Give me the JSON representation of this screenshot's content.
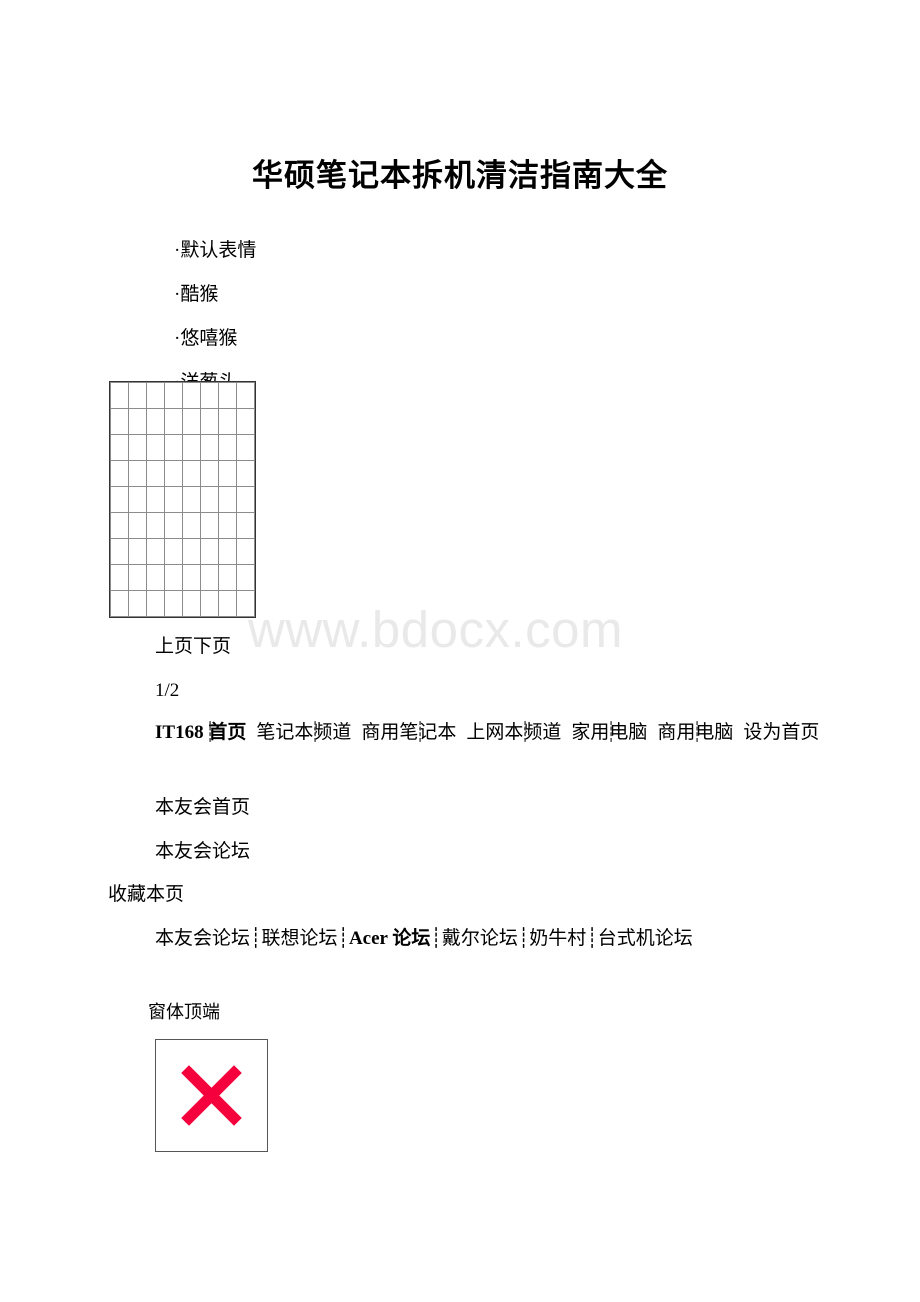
{
  "document": {
    "title": "华硕笔记本拆机清洁指南大全",
    "watermark": "www.bdocx.com"
  },
  "emoticon_list": [
    {
      "bullet": "·",
      "label": "默认表情"
    },
    {
      "bullet": "·",
      "label": "酷猴"
    },
    {
      "bullet": "·",
      "label": "悠嘻猴"
    },
    {
      "bullet": "·",
      "label": "洋葱头"
    }
  ],
  "emoticon_grid": {
    "columns": 8,
    "rows": 9,
    "cells_empty": true,
    "border_color": "#8c8c8c",
    "outline_color": "#333333"
  },
  "pager": {
    "prev_next": "上页下页",
    "page_indicator": "1/2"
  },
  "site_nav": {
    "separator": "┊",
    "items": [
      "IT168 首页",
      "笔记本频道",
      "商用笔记本",
      "上网本频道",
      "家用电脑",
      "商用电脑",
      "设为首页"
    ]
  },
  "club_links": [
    "本友会首页",
    "本友会论坛",
    "收藏本页"
  ],
  "forum_nav": {
    "separator": "┊",
    "items": [
      "本友会论坛",
      "联想论坛",
      "Acer 论坛",
      "戴尔论坛",
      "奶牛村",
      "台式机论坛"
    ]
  },
  "form": {
    "top_marker": "窗体顶端"
  },
  "broken_image": {
    "alt_glyph": "×",
    "x_color": "#f5003c",
    "border_color": "#565656"
  }
}
